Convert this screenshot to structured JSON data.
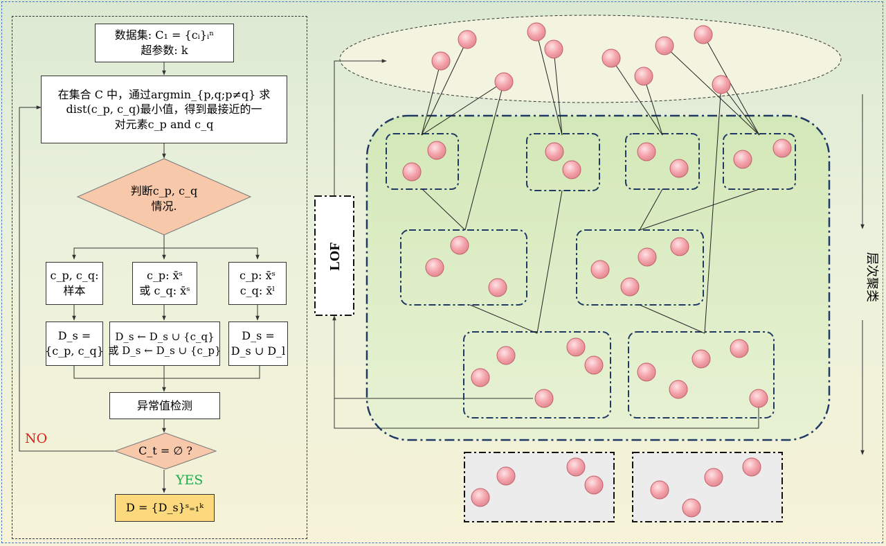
{
  "flowchart": {
    "input": [
      "数据集: C₁ = {cᵢ}ᵢⁿ",
      "超参数: k"
    ],
    "step": [
      "在集合 C 中，通过argmin_{p,q;p≠q} 求",
      "dist(c_p, c_q)最小值，得到最接近的一",
      "对元素c_p and c_q"
    ],
    "decision": [
      "判断c_p, c_q",
      "情况."
    ],
    "case_left": [
      "c_p, c_q:",
      "样本"
    ],
    "case_mid": [
      "c_p: x̄ˢ",
      "或 c_q: x̄ˢ"
    ],
    "case_right": [
      "c_p: x̄ˢ",
      "c_q: x̄ˡ"
    ],
    "merge_left": [
      "D_s =",
      "{c_p, c_q}"
    ],
    "merge_mid": [
      "D_s ← D_s ∪ {c_q}",
      "或 D_s ← D_s ∪ {c_p}"
    ],
    "merge_right": [
      "D_s =",
      "D_s ∪ D_l"
    ],
    "outlier": "异常值检测",
    "condition": "C_t = ∅ ?",
    "no_label": "NO",
    "yes_label": "YES",
    "result": "D = {D_s}ˢ₌₁ᵏ"
  },
  "right": {
    "lof_label": "LOF",
    "direction_label": "层次聚类"
  },
  "colors": {
    "node_fill": "#f2aeb4",
    "diamond_fill": "#f8c8aa",
    "result_fill": "#fbd97c",
    "cluster_border": "#1f3864",
    "no_color": "#e0201a",
    "yes_color": "#1eac4a"
  }
}
